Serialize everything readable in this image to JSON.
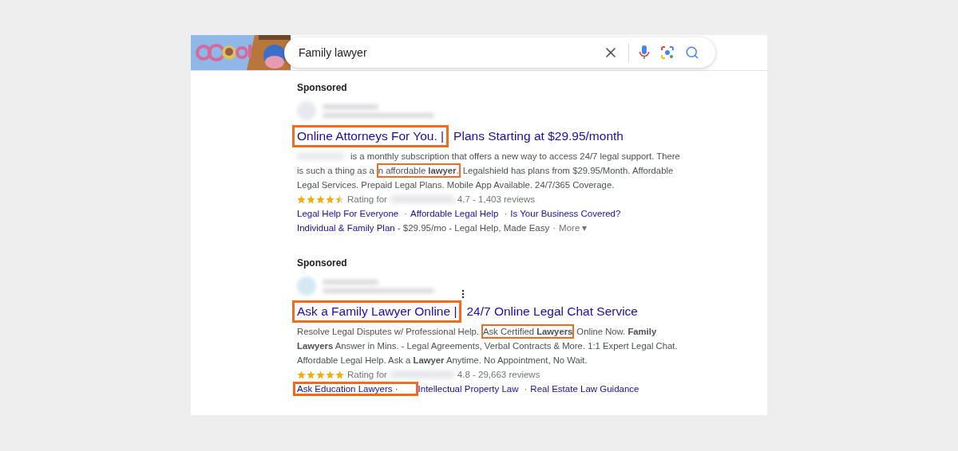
{
  "search": {
    "value": "Family lawyer"
  },
  "ads": [
    {
      "label": "Sponsored",
      "has_menu": false,
      "title": [
        {
          "text": "Online Attorneys For You. |",
          "highlight": true
        },
        {
          "text": " Plans Starting at $29.95/month",
          "highlight": false
        }
      ],
      "description_lines": [
        [
          {
            "text": "is a monthly subscription that offers a new way to access 24/7 legal support. There",
            "highlight": false
          }
        ],
        [
          {
            "text": "is such a thing as a",
            "highlight": false
          },
          {
            "text": "n affordable **lawyer**.",
            "highlight": true
          },
          {
            "text": "Legalshield has plans from $29.95/Month. Affordable",
            "highlight": false
          }
        ],
        [
          {
            "text": "Legal Services. Prepaid Legal Plans. Mobile App Available. 24/7/365 Coverage.",
            "highlight": false
          }
        ]
      ],
      "stars": 4.5,
      "rating_label": "Rating for",
      "rating": "4.7 - 1,403 reviews",
      "sitelink_rows": [
        {
          "separator": "·",
          "links": [
            {
              "text": "Legal Help For Everyone",
              "highlight": false
            },
            {
              "text": "Affordable Legal Help",
              "highlight": false
            },
            {
              "text": "Is Your Business Covered?",
              "highlight": false
            }
          ]
        },
        {
          "separator": "·",
          "links": [
            {
              "text": "Individual & Family Plan",
              "highlight": false,
              "suffix": " - $29.95/mo - Legal Help, Made Easy"
            },
            {
              "text": "More",
              "caret": "▾",
              "highlight": false,
              "kind": "more"
            }
          ]
        }
      ]
    },
    {
      "label": "Sponsored",
      "has_menu": true,
      "title": [
        {
          "text": "Ask a Family Lawyer Online |",
          "highlight": true
        },
        {
          "text": " 24/7 Online Legal Chat Service",
          "highlight": false
        }
      ],
      "description_lines": [
        [
          {
            "text": "Resolve Legal Disputes w/ Professional Help.",
            "highlight": false
          },
          {
            "text": "Ask Certified **Lawyers**",
            "highlight": true
          },
          {
            "text": "Online Now. **Family**",
            "highlight": false
          }
        ],
        [
          {
            "text": "**Lawyers** Answer in Mins. - Legal Agreements, Verbal Contracts & More. 1:1 Expert Legal Chat.",
            "highlight": false
          }
        ],
        [
          {
            "text": "Affordable Legal Help. Ask a **Lawyer** Anytime. No Appointment, No Wait.",
            "highlight": false
          }
        ]
      ],
      "stars": 5,
      "rating_label": "Rating for",
      "rating": "4.8 - 29,663 reviews",
      "sitelink_rows": [
        {
          "separator": "·",
          "links": [
            {
              "text": "Ask Education Lawyers ·",
              "highlight": true
            },
            {
              "text": "Intellectual Property Law",
              "highlight": false
            },
            {
              "text": "Real Estate Law Guidance",
              "highlight": false
            }
          ]
        }
      ]
    }
  ]
}
